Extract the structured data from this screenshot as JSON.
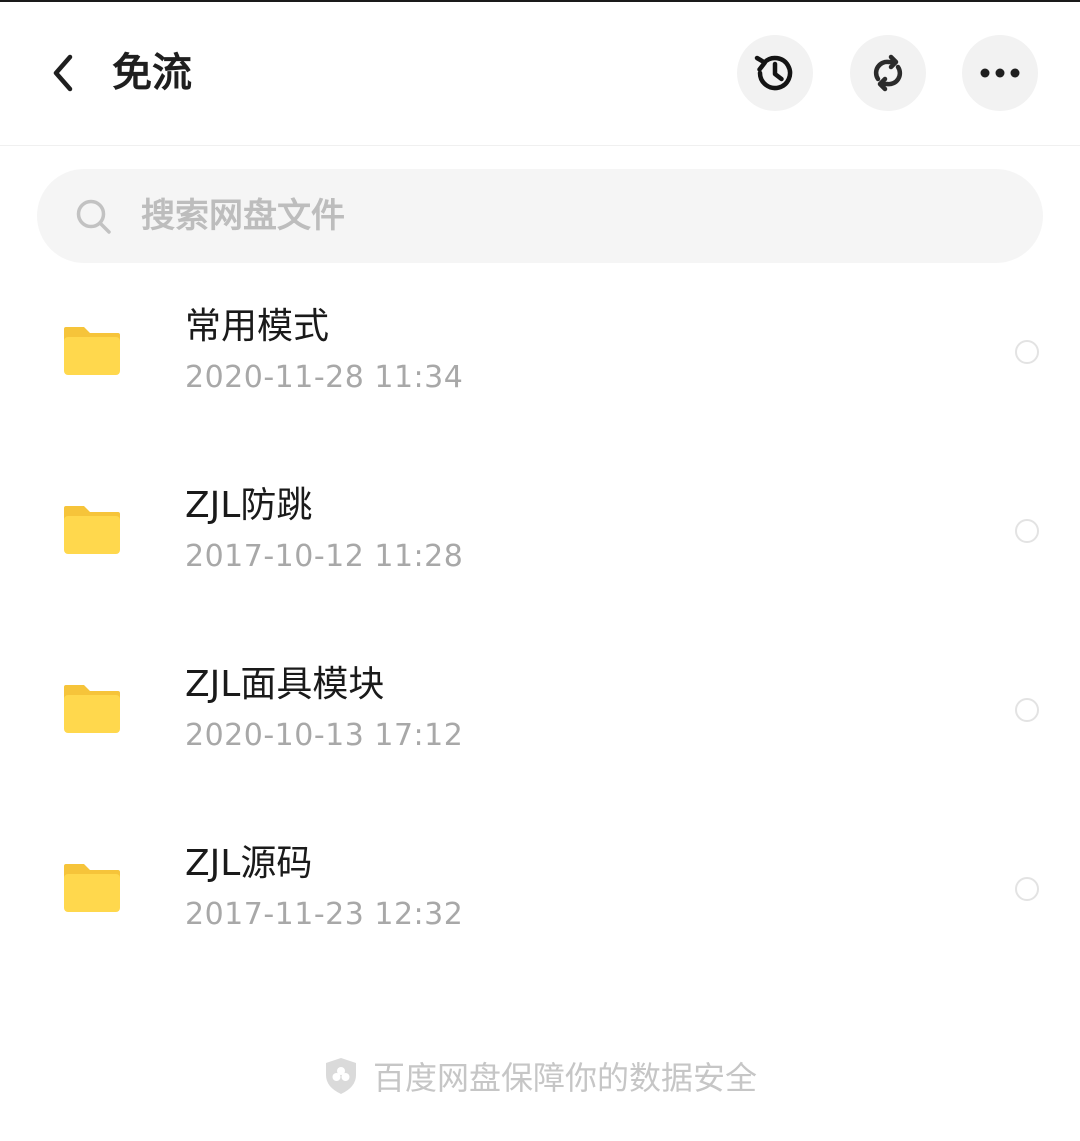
{
  "header": {
    "title": "免流",
    "icons": {
      "back": "back-chevron-icon",
      "history": "history-clock-icon",
      "sync": "sync-icon",
      "more": "more-dots-icon"
    }
  },
  "search": {
    "placeholder": "搜索网盘文件",
    "icon": "search-icon"
  },
  "files": [
    {
      "name": "常用模式",
      "date": "2020-11-28  11:34",
      "type": "folder"
    },
    {
      "name": "ZJL防跳",
      "date": "2017-10-12  11:28",
      "type": "folder"
    },
    {
      "name": "ZJL面具模块",
      "date": "2020-10-13  17:12",
      "type": "folder"
    },
    {
      "name": "ZJL源码",
      "date": "2017-11-23  12:32",
      "type": "folder"
    }
  ],
  "footer": {
    "text": "百度网盘保障你的数据安全",
    "icon": "shield-icon"
  },
  "colors": {
    "folder": "#FFD84D",
    "folder_tab": "#F6C43A",
    "title": "#1F1F1F",
    "muted": "#A8A8A8",
    "button_bg": "#F2F2F2"
  }
}
